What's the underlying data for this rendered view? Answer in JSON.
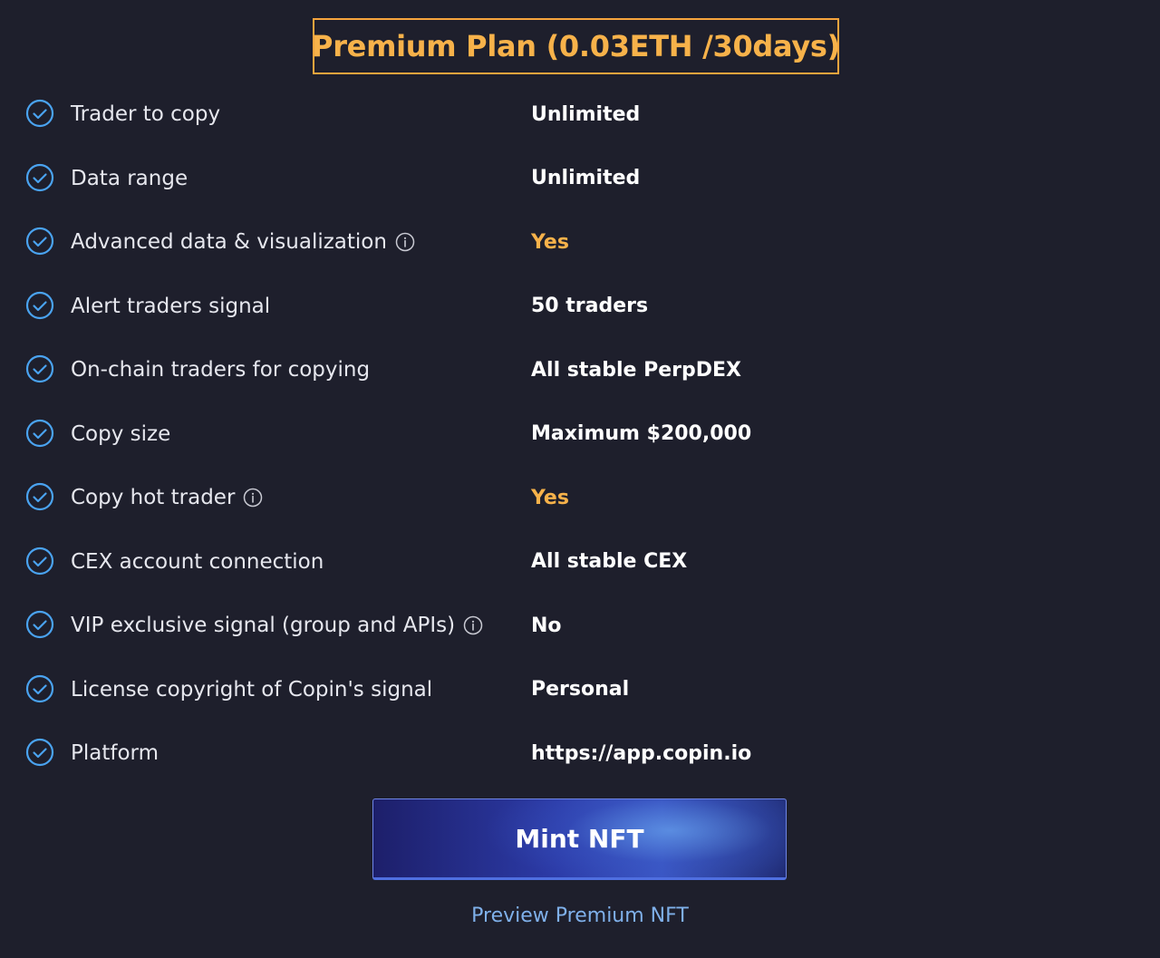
{
  "plan": {
    "title": "Premium Plan (0.03ETH /30days)"
  },
  "colors": {
    "background": "#1e1f2c",
    "accent": "#f7b24a",
    "check": "#4aa3f0",
    "link": "#7fb0ea"
  },
  "features": [
    {
      "label": "Trader to copy",
      "value": "Unlimited",
      "has_info": false,
      "accent": false,
      "check_icon": "check-circle-icon"
    },
    {
      "label": "Data range",
      "value": "Unlimited",
      "has_info": false,
      "accent": false,
      "check_icon": "check-circle-icon"
    },
    {
      "label": "Advanced data & visualization",
      "value": "Yes",
      "has_info": true,
      "accent": true,
      "check_icon": "check-circle-icon"
    },
    {
      "label": "Alert traders signal",
      "value": "50 traders",
      "has_info": false,
      "accent": false,
      "check_icon": "check-circle-icon"
    },
    {
      "label": "On-chain traders for copying",
      "value": "All stable PerpDEX",
      "has_info": false,
      "accent": false,
      "check_icon": "check-circle-icon"
    },
    {
      "label": "Copy size",
      "value": "Maximum $200,000",
      "has_info": false,
      "accent": false,
      "check_icon": "check-circle-icon"
    },
    {
      "label": "Copy hot trader",
      "value": "Yes",
      "has_info": true,
      "accent": true,
      "check_icon": "check-circle-icon"
    },
    {
      "label": "CEX account connection",
      "value": "All stable CEX",
      "has_info": false,
      "accent": false,
      "check_icon": "check-circle-icon"
    },
    {
      "label": "VIP exclusive signal (group and APIs)",
      "value": "No",
      "has_info": true,
      "accent": false,
      "check_icon": "check-circle-icon"
    },
    {
      "label": "License copyright of Copin's signal",
      "value": "Personal",
      "has_info": false,
      "accent": false,
      "check_icon": "check-circle-icon"
    },
    {
      "label": "Platform",
      "value": "https://app.copin.io",
      "has_info": false,
      "accent": false,
      "check_icon": "check-circle-icon"
    }
  ],
  "actions": {
    "mint_label": "Mint NFT",
    "preview_label": "Preview Premium NFT"
  }
}
